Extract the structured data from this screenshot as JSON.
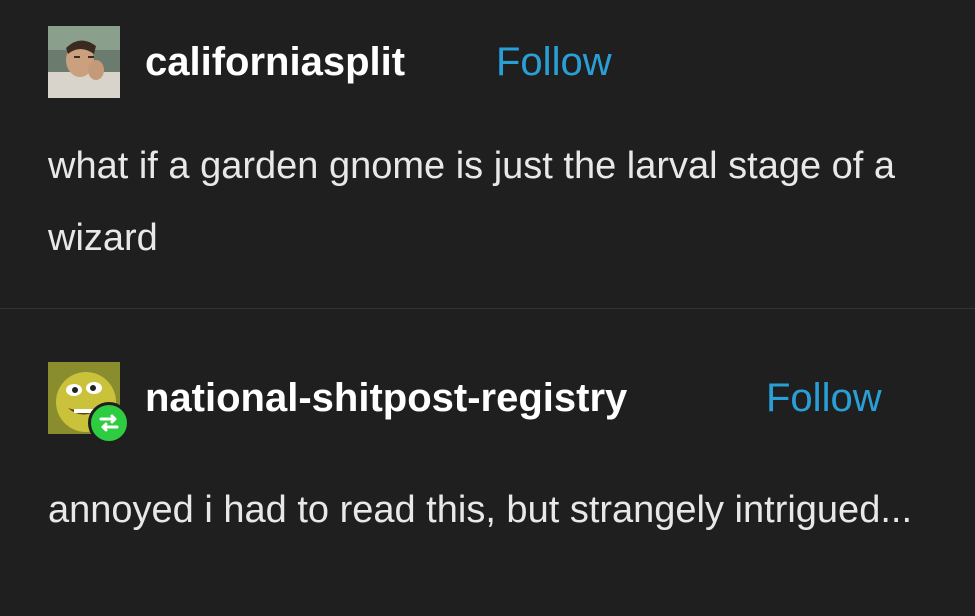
{
  "posts": [
    {
      "username": "californiasplit",
      "follow_label": "Follow",
      "text": "what if a garden gnome is just the larval stage of a wizard",
      "avatar_icon": "user-photo-avatar"
    },
    {
      "username": "national-shitpost-registry",
      "follow_label": "Follow",
      "text": "annoyed i had to read this, but strangely intrigued...",
      "avatar_icon": "green-face-avatar",
      "badge_icon": "reblog-icon"
    }
  ],
  "colors": {
    "background": "#1f1f1f",
    "text": "#e8e8e8",
    "username": "#ffffff",
    "follow": "#2a9fd6",
    "reblog_badge": "#2ecc40"
  }
}
